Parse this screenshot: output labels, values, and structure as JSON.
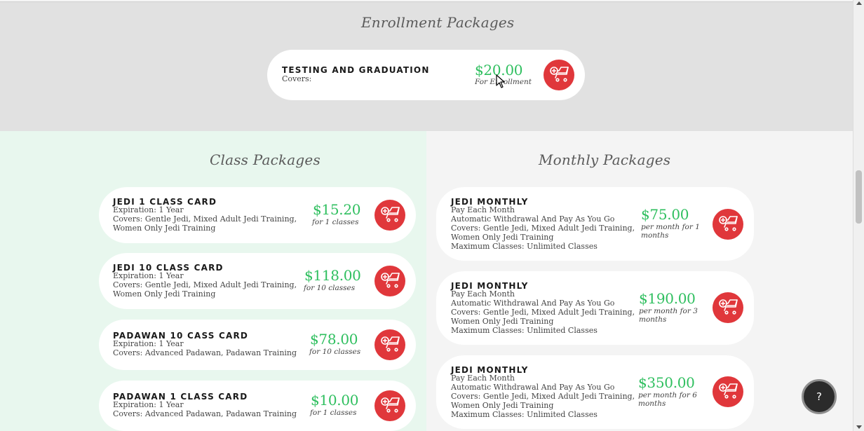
{
  "enrollment": {
    "title": "Enrollment Packages",
    "items": [
      {
        "name": "TESTING AND GRADUATION",
        "desc": [
          "Covers:"
        ],
        "price": "$20.00",
        "price_label": [
          "For Enrollment"
        ]
      }
    ]
  },
  "class_packages": {
    "title": "Class Packages",
    "items": [
      {
        "name": "JEDI 1 CLASS CARD",
        "desc": [
          "Expiration: 1 Year",
          "Covers: Gentle Jedi, Mixed Adult Jedi Training,",
          "Women Only Jedi Training"
        ],
        "price": "$15.20",
        "price_label": [
          "for 1 classes"
        ]
      },
      {
        "name": "JEDI 10 CLASS CARD",
        "desc": [
          "Expiration: 1 Year",
          "Covers: Gentle Jedi, Mixed Adult Jedi Training,",
          "Women Only Jedi Training"
        ],
        "price": "$118.00",
        "price_label": [
          "for 10 classes"
        ]
      },
      {
        "name": "PADAWAN 10 CASS CARD",
        "desc": [
          "Expiration: 1 Year",
          "Covers: Advanced Padawan, Padawan Training"
        ],
        "price": "$78.00",
        "price_label": [
          "for 10 classes"
        ]
      },
      {
        "name": "PADAWAN 1 CLASS CARD",
        "desc": [
          "Expiration: 1 Year",
          "Covers: Advanced Padawan, Padawan Training"
        ],
        "price": "$10.00",
        "price_label": [
          "for 1 classes"
        ]
      }
    ]
  },
  "monthly_packages": {
    "title": "Monthly Packages",
    "items": [
      {
        "name": "JEDI MONTHLY",
        "desc": [
          "Pay Each Month",
          "Automatic Withdrawal And Pay As You Go",
          "Covers: Gentle Jedi, Mixed Adult Jedi Training,",
          "Women Only Jedi Training",
          "Maximum Classes: Unlimited Classes"
        ],
        "price": "$75.00",
        "price_label": [
          "per month for 1",
          "months"
        ]
      },
      {
        "name": "JEDI MONTHLY",
        "desc": [
          "Pay Each Month",
          "Automatic Withdrawal And Pay As You Go",
          "Covers: Gentle Jedi, Mixed Adult Jedi Training,",
          "Women Only Jedi Training",
          "Maximum Classes: Unlimited Classes"
        ],
        "price": "$190.00",
        "price_label": [
          "per month for 3",
          "months"
        ]
      },
      {
        "name": "JEDI MONTHLY",
        "desc": [
          "Pay Each Month",
          "Automatic Withdrawal And Pay As You Go",
          "Covers: Gentle Jedi, Mixed Adult Jedi Training,",
          "Women Only Jedi Training",
          "Maximum Classes: Unlimited Classes"
        ],
        "price": "$350.00",
        "price_label": [
          "per month for 6",
          "months"
        ]
      }
    ]
  },
  "help_button": {
    "label": "?"
  },
  "icons": {
    "cart": "add-to-cart-icon",
    "help": "question-icon",
    "cursor": "mouse-pointer"
  },
  "colors": {
    "price": "#2fbf5f",
    "cart_button": "#e0373b",
    "enrollment_bg": "#e1e1e1",
    "class_bg": "#e8f7ee",
    "monthly_bg": "#f4f4f4"
  }
}
